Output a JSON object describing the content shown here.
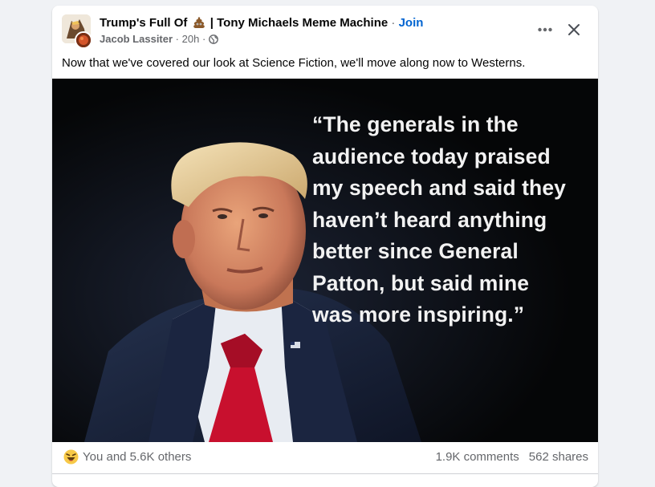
{
  "post": {
    "group_name": "Trump's Full Of",
    "group_suffix": "| Tony Michaels Meme Machine",
    "separator": "·",
    "join_label": "Join",
    "author": "Jacob Lassiter",
    "time": "20h",
    "text": "Now that we've covered our look at Science Fiction, we'll move along now to Westerns."
  },
  "image": {
    "quote_lines": [
      "“The generals in the",
      "audience today praised",
      "my speech and said they",
      "haven’t heard anything",
      "better since General",
      "Patton, but said mine",
      "was more inspiring.”"
    ]
  },
  "footer": {
    "reaction_icon": "laughing-emoji",
    "reactors": "You and 5.6K others",
    "comments": "1.9K comments",
    "shares": "562 shares"
  },
  "icons": {
    "more": "more-horizontal-icon",
    "close": "close-icon",
    "privacy": "globe-icon",
    "emoji": "poop-emoji"
  },
  "colors": {
    "link": "#0064d1",
    "secondary_text": "#65676b",
    "image_background": "#050607",
    "tie": "#c8102e",
    "suit": "#1b2540"
  }
}
